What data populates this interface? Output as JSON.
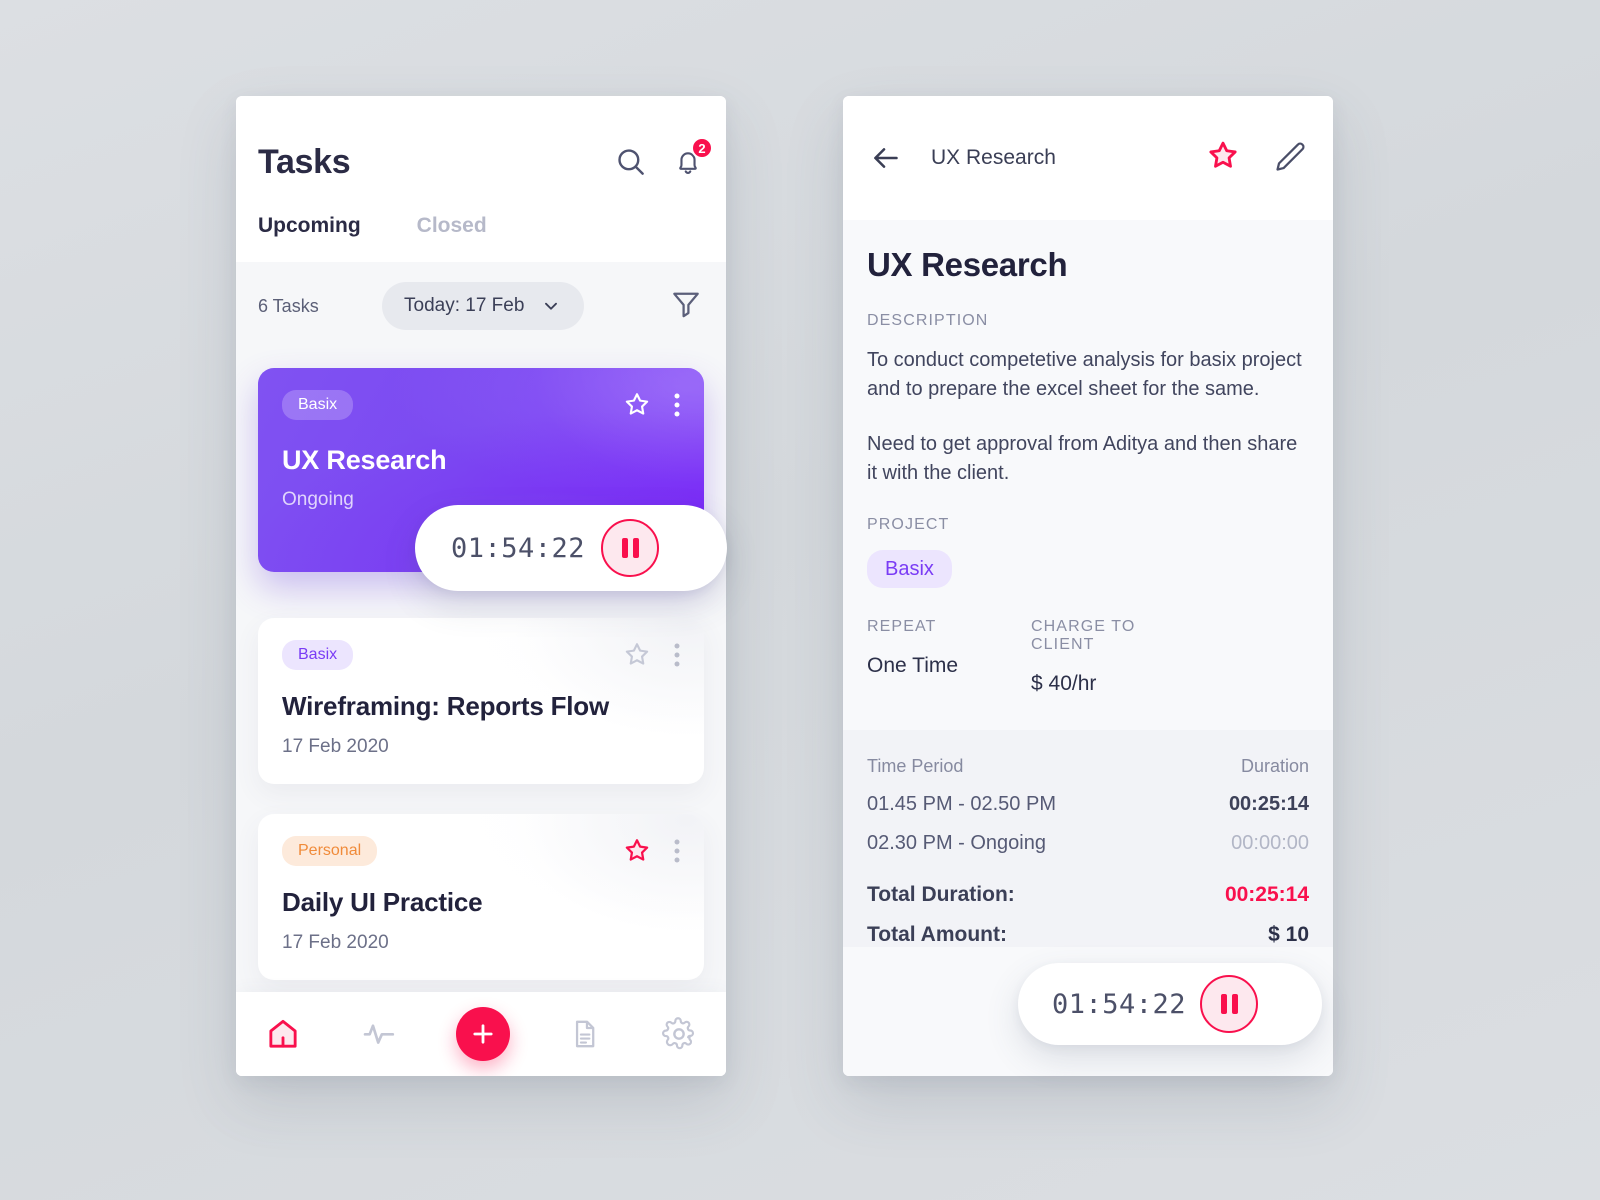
{
  "left": {
    "header": {
      "title": "Tasks",
      "search_icon": "search-icon",
      "bell_icon": "bell-icon",
      "notification_count": "2"
    },
    "tabs": [
      {
        "label": "Upcoming",
        "active": true
      },
      {
        "label": "Closed",
        "active": false
      }
    ],
    "filter_bar": {
      "count_label": "6 Tasks",
      "date_pill": "Today: 17 Feb",
      "chevron_icon": "chevron-down-icon",
      "filter_icon": "filter-icon"
    },
    "cards": [
      {
        "chip": "Basix",
        "title": "UX Research",
        "subtitle": "Ongoing",
        "starred": false,
        "accent": "#7b49f1"
      },
      {
        "chip": "Basix",
        "title": "Wireframing: Reports Flow",
        "date": "17 Feb 2020",
        "starred": false
      },
      {
        "chip": "Personal",
        "title": "Daily UI Practice",
        "date": "17 Feb 2020",
        "starred": true
      }
    ],
    "timer": {
      "time": "01:54:22",
      "button_icon": "pause-icon"
    },
    "nav": [
      {
        "name": "home",
        "icon": "home-icon",
        "active": true
      },
      {
        "name": "activity",
        "icon": "activity-icon",
        "active": false
      },
      {
        "name": "add",
        "icon": "plus-icon",
        "active": false
      },
      {
        "name": "documents",
        "icon": "document-icon",
        "active": false
      },
      {
        "name": "settings",
        "icon": "gear-icon",
        "active": false
      }
    ]
  },
  "right": {
    "topbar": {
      "back_icon": "arrow-left-icon",
      "title": "UX Research",
      "star_icon": "star-icon",
      "edit_icon": "pencil-icon"
    },
    "title": "UX Research",
    "description_label": "DESCRIPTION",
    "description_p1": "To conduct competetive analysis for basix project and to prepare the excel sheet for the same.",
    "description_p2": "Need to get approval from Aditya and then share it with the client.",
    "project_label": "PROJECT",
    "project_value": "Basix",
    "repeat_label": "REPEAT",
    "repeat_value": "One Time",
    "charge_label": "CHARGE TO CLIENT",
    "charge_value": "$ 40/hr",
    "time_table": {
      "col_time": "Time Period",
      "col_duration": "Duration",
      "rows": [
        {
          "period": "01.45 PM - 02.50 PM",
          "duration": "00:25:14",
          "muted": false
        },
        {
          "period": "02.30 PM - Ongoing",
          "duration": "00:00:00",
          "muted": true
        }
      ],
      "total_duration_label": "Total Duration:",
      "total_duration_value": "00:25:14",
      "total_amount_label": "Total Amount:",
      "total_amount_value": "$ 10"
    },
    "timer": {
      "time": "01:54:22",
      "button_icon": "pause-icon"
    }
  },
  "colors": {
    "accent_pink": "#f9104d",
    "accent_purple": "#7b49f1",
    "chip_orange": "#f08b3a",
    "page_bg": "#d6d9dd"
  }
}
